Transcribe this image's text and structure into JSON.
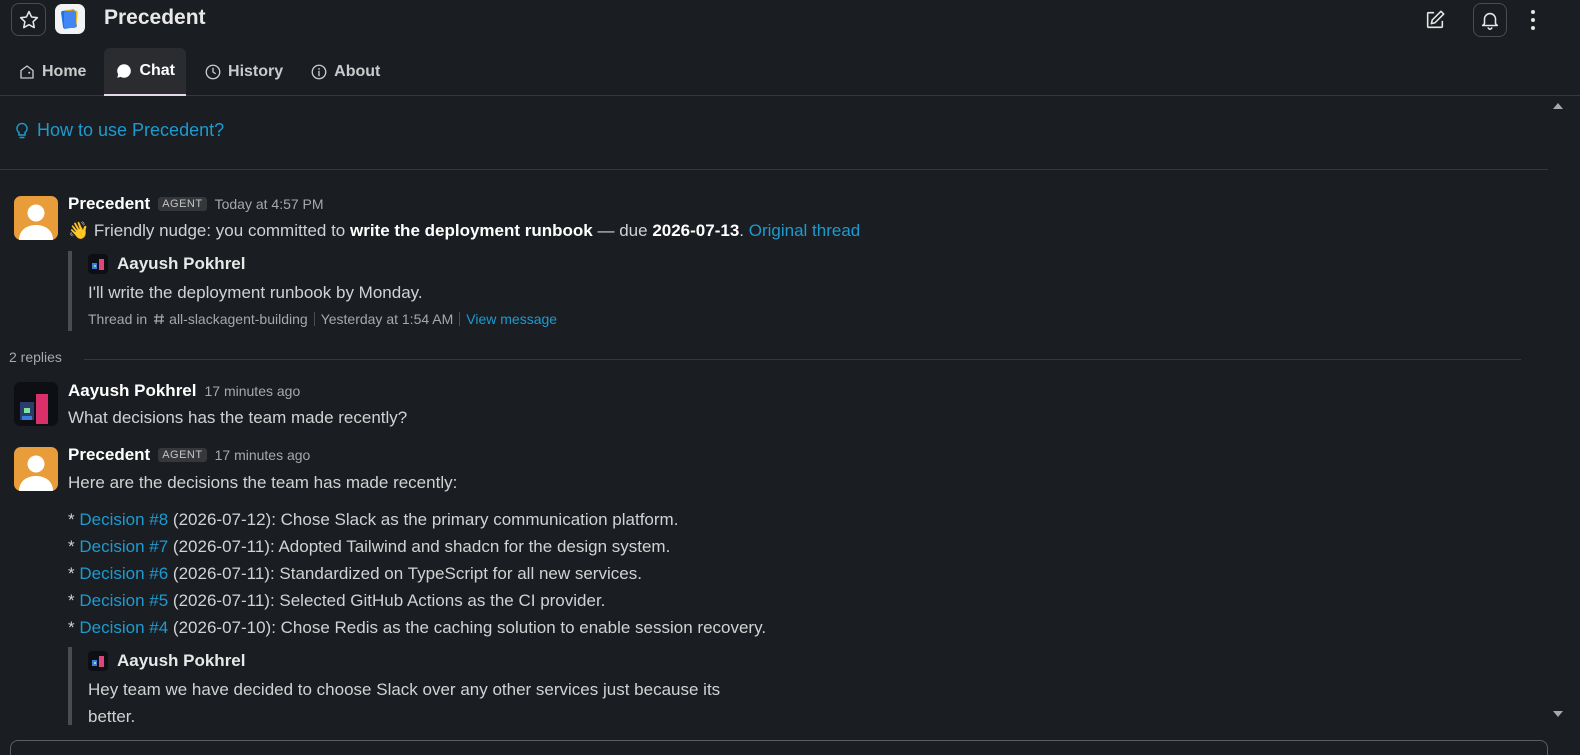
{
  "header": {
    "app_name": "Precedent",
    "tabs": [
      {
        "label": "Home",
        "icon": "home-icon"
      },
      {
        "label": "Chat",
        "icon": "chat-icon"
      },
      {
        "label": "History",
        "icon": "clock-icon"
      },
      {
        "label": "About",
        "icon": "info-icon"
      }
    ],
    "active_tab": "Chat"
  },
  "help_link": "How to use Precedent?",
  "messages": [
    {
      "sender": "Precedent",
      "badge": "AGENT",
      "time": "Today at 4:57 PM",
      "emoji": "👋",
      "text_prefix": "Friendly nudge: you committed to",
      "bold_task": "write the deployment runbook",
      "text_mid": "— due",
      "bold_date": "2026-07-13",
      "text_end": ".",
      "link": "Original thread",
      "quote": {
        "author": "Aayush Pokhrel",
        "text": "I'll write the deployment runbook by Monday.",
        "thread_prefix": "Thread in",
        "channel": "all-slackagent-building",
        "time": "Yesterday at 1:54 AM",
        "link": "View message"
      }
    },
    {
      "sender": "Aayush Pokhrel",
      "time": "17 minutes ago",
      "text": "What decisions has the team made recently?"
    },
    {
      "sender": "Precedent",
      "badge": "AGENT",
      "time": "17 minutes ago",
      "intro": "Here are the decisions the team has made recently:",
      "decisions": [
        {
          "bullet": "*",
          "link": "Decision #8",
          "text": "(2026-07-12): Chose Slack as the primary communication platform."
        },
        {
          "bullet": "*",
          "link": "Decision #7",
          "text": "(2026-07-11): Adopted Tailwind and shadcn for the design system."
        },
        {
          "bullet": "*",
          "link": "Decision #6",
          "text": "(2026-07-11): Standardized on TypeScript for all new services."
        },
        {
          "bullet": "*",
          "link": "Decision #5",
          "text": "(2026-07-11): Selected GitHub Actions as the CI provider."
        },
        {
          "bullet": "*",
          "link": "Decision #4",
          "text": "(2026-07-10): Chose Redis as the caching solution to enable session recovery."
        }
      ],
      "quote": {
        "author": "Aayush Pokhrel",
        "text_line1": "Hey team we have decided to choose Slack over any other services just because its",
        "text_line2": "better."
      }
    }
  ],
  "replies_label": "2 replies",
  "colors": {
    "background": "#1a1d21",
    "link": "#1d9bd1",
    "bot_avatar": "#e99c3a"
  }
}
